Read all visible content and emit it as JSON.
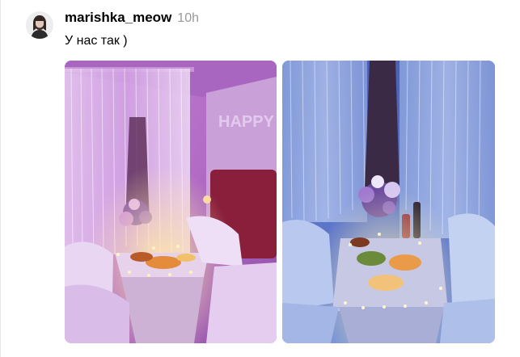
{
  "post": {
    "username": "marishka_meow",
    "timestamp": "10h",
    "text": "У нас так )",
    "images": [
      {
        "name": "train-compartment-left",
        "dominant_color": "#b56cc4"
      },
      {
        "name": "train-compartment-right",
        "dominant_color": "#5a74c8"
      }
    ]
  },
  "colors": {
    "username": "#000000",
    "timestamp": "#999999",
    "divider": "#e6e6e6"
  }
}
